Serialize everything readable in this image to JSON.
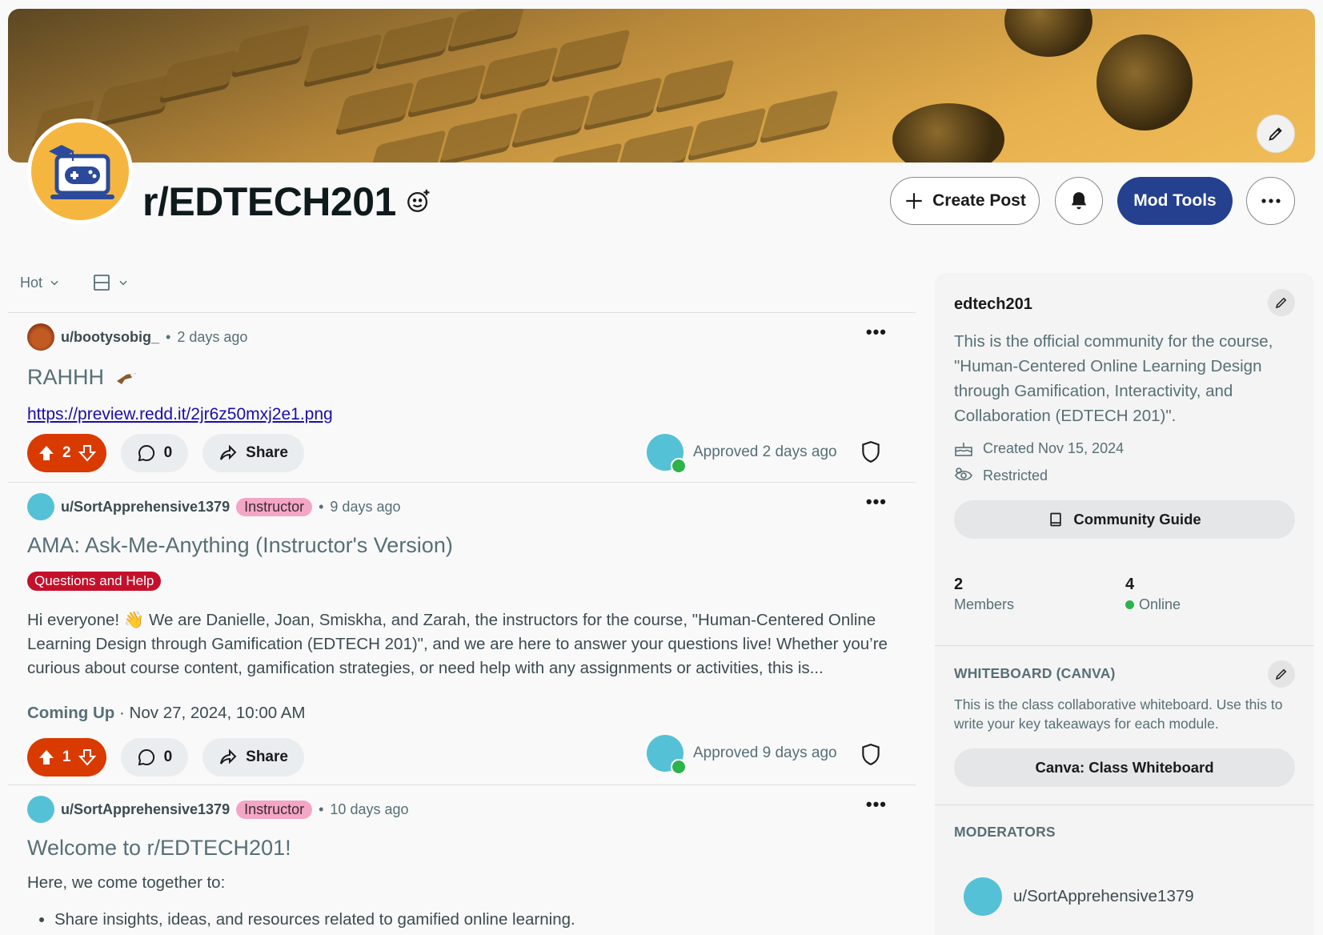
{
  "community": {
    "title": "r/EDTECH201",
    "create_post_label": "Create Post",
    "mod_tools_label": "Mod Tools"
  },
  "sort": {
    "label": "Hot"
  },
  "posts": [
    {
      "user": "u/bootysobig_",
      "time": "2 days ago",
      "title": "RAHHH",
      "link": "https://preview.redd.it/2jr6z50mxj2e1.png",
      "votes": "2",
      "comments": "0",
      "share_label": "Share",
      "approved": "Approved 2 days ago"
    },
    {
      "user": "u/SortApprehensive1379",
      "flair": "Instructor",
      "time": "9 days ago",
      "title": "AMA: Ask-Me-Anything (Instructor's Version)",
      "tag": "Questions and Help",
      "body": "Hi everyone! 👋 We are Danielle, Joan, Smiskha, and Zarah, the instructors for the course, \"Human-Centered Online Learning Design through Gamification (EDTECH 201)\", and we are here to answer your questions live! Whether you’re curious about course content, gamification strategies, or need help with any assignments or activities, this is...",
      "coming_label": "Coming Up",
      "coming_date": "· Nov 27, 2024, 10:00 AM",
      "votes": "1",
      "comments": "0",
      "share_label": "Share",
      "approved": "Approved 9 days ago"
    },
    {
      "user": "u/SortApprehensive1379",
      "flair": "Instructor",
      "time": "10 days ago",
      "title": "Welcome to r/EDTECH201!",
      "intro": "Here, we come together to:",
      "bullets": [
        "Share insights, ideas, and resources related to gamified online learning."
      ]
    }
  ],
  "sidebar": {
    "name": "edtech201",
    "description": "This is the official community for the course, \"Human-Centered Online Learning Design through Gamification, Interactivity, and Collaboration (EDTECH 201)\".",
    "created": "Created Nov 15, 2024",
    "type": "Restricted",
    "guide_label": "Community Guide",
    "members_count": "2",
    "members_label": "Members",
    "online_count": "4",
    "online_label": "Online",
    "whiteboard_heading": "WHITEBOARD (CANVA)",
    "whiteboard_text": "This is the class collaborative whiteboard. Use this to write your key takeaways for each module.",
    "whiteboard_button": "Canva: Class Whiteboard",
    "moderators_heading": "MODERATORS",
    "moderator_name": "u/SortApprehensive1379"
  },
  "colors": {
    "accent": "#24408e",
    "upvote": "#d93a00",
    "flair": "#f3a6c6",
    "tag": "#c4102b",
    "online": "#2cb34a"
  }
}
